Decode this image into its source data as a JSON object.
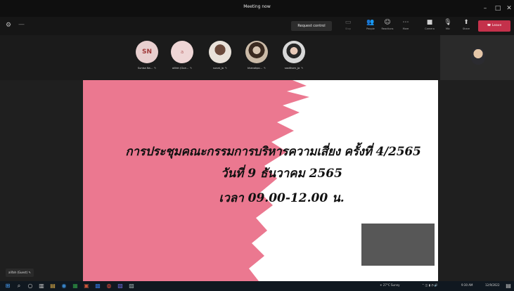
{
  "window": {
    "title": "Meeting now"
  },
  "toolbar": {
    "request_control_label": "Request control",
    "tools": [
      {
        "icon": "stop-share-icon",
        "label": "Stop"
      },
      {
        "icon": "people-icon",
        "label": "People"
      },
      {
        "icon": "reactions-icon",
        "label": "Reactions"
      },
      {
        "icon": "more-icon",
        "label": "More"
      },
      {
        "icon": "camera-icon",
        "label": "Camera"
      },
      {
        "icon": "mic-icon",
        "label": "Mic"
      },
      {
        "icon": "share-icon",
        "label": "Share"
      }
    ],
    "leave_label": "Leave"
  },
  "participants": [
    {
      "initials": "SN",
      "name": "Sunisa Na...",
      "avatar": "initials"
    },
    {
      "initials": "a",
      "name": "alifah (Gue...",
      "avatar": "initials"
    },
    {
      "initials": "",
      "name": "sunat_ja",
      "avatar": "photo"
    },
    {
      "initials": "",
      "name": "khanokpo...",
      "avatar": "photo"
    },
    {
      "initials": "",
      "name": "sasithorn_ja",
      "avatar": "photo"
    }
  ],
  "slide": {
    "line1": "การประชุมคณะกรรมการบริหารความเสี่ยง ครั้งที่ 4/2565",
    "line2": "วันที่ 9 ธันวาคม 2565",
    "line3": "เวลา 09.00-12.00 น.",
    "accent_color": "#eb7890"
  },
  "sharer": {
    "label": "alifah (Guest)"
  },
  "taskbar": {
    "weather": "27°C Sunny",
    "time": "9:30 AM",
    "date": "12/9/2022"
  }
}
